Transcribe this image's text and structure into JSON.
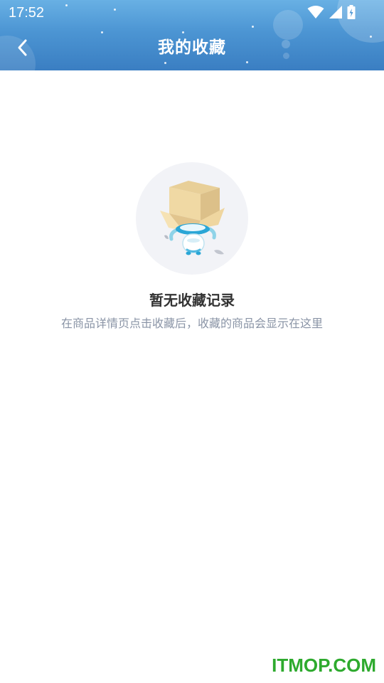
{
  "status_bar": {
    "time": "17:52",
    "icons": [
      "wifi-icon",
      "cellular-signal-icon",
      "battery-charging-icon"
    ]
  },
  "app_bar": {
    "back_icon": "chevron-left-icon",
    "title": "我的收藏"
  },
  "empty_state": {
    "illustration": "robot-with-box-illustration",
    "title": "暂无收藏记录",
    "subtitle": "在商品详情页点击收藏后，收藏的商品会显示在这里"
  },
  "watermark": {
    "text": "ITMOP.COM"
  },
  "colors": {
    "header_top": "#68b0e4",
    "header_bottom": "#3a7ec2",
    "title_text": "#333333",
    "subtitle_text": "#8a94a6",
    "watermark": "#2eaa2e"
  }
}
